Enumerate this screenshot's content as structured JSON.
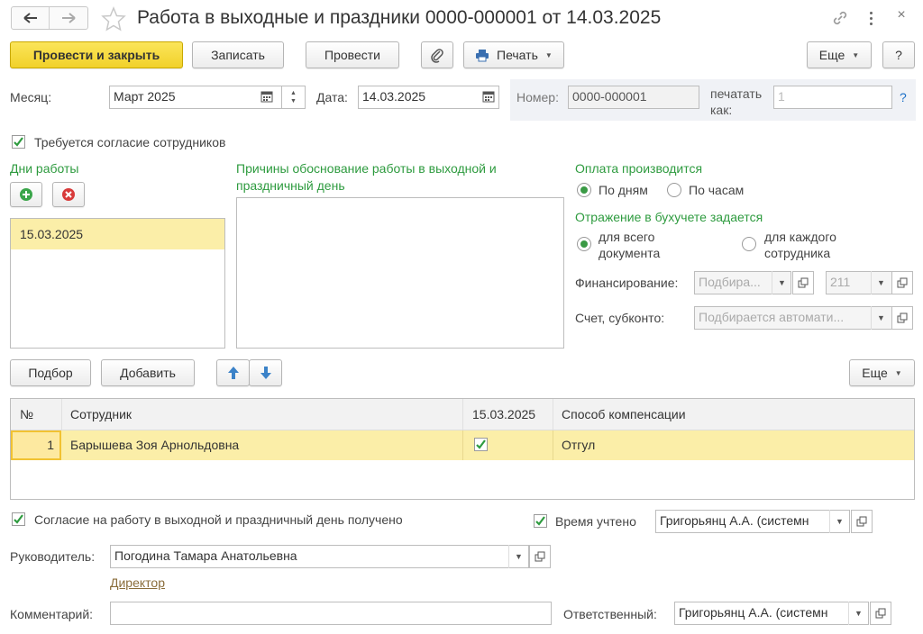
{
  "window": {
    "title": "Работа в выходные и праздники 0000-000001 от 14.03.2025"
  },
  "toolbar": {
    "post_close": "Провести и закрыть",
    "save": "Записать",
    "post": "Провести",
    "print": "Печать",
    "more": "Еще",
    "help": "?"
  },
  "header": {
    "month_label": "Месяц:",
    "month_value": "Март 2025",
    "date_label": "Дата:",
    "date_value": "14.03.2025",
    "number_label": "Номер:",
    "number_value": "0000-000001",
    "print_as_label_1": "печатать",
    "print_as_label_2": "как:",
    "print_as_placeholder": "1",
    "help_q": "?"
  },
  "consent_required": {
    "label": "Требуется согласие сотрудников",
    "checked": true
  },
  "workdays": {
    "title": "Дни работы",
    "items": [
      "15.03.2025"
    ]
  },
  "reasons": {
    "title_line1": "Причины обоснование работы в выходной и",
    "title_line2": "праздничный день",
    "value": ""
  },
  "payment": {
    "title": "Оплата производится",
    "by_days": "По дням",
    "by_hours": "По часам",
    "selected": "by_days"
  },
  "accounting": {
    "title": "Отражение в бухучете задается",
    "whole_doc_1": "для всего",
    "whole_doc_2": "документа",
    "each_emp_1": "для каждого",
    "each_emp_2": "сотрудника",
    "selected": "whole_doc",
    "financing_label": "Финансирование:",
    "financing_placeholder": "Подбира...",
    "financing_code": "211",
    "account_label": "Счет, субконто:",
    "account_placeholder": "Подбирается автомати..."
  },
  "table_toolbar": {
    "select": "Подбор",
    "add": "Добавить",
    "more": "Еще"
  },
  "table": {
    "columns": [
      "№",
      "Сотрудник",
      "15.03.2025",
      "Способ компенсации"
    ],
    "rows": [
      {
        "num": "1",
        "employee": "Барышева Зоя Арнольдовна",
        "day_checked": true,
        "compensation": "Отгул"
      }
    ]
  },
  "footer": {
    "consent_received_label": "Согласие на работу в выходной и праздничный день получено",
    "consent_received_checked": true,
    "time_accounted_label": "Время учтено",
    "time_accounted_checked": true,
    "time_accounted_value": "Григорьянц А.А. (системн",
    "manager_label": "Руководитель:",
    "manager_value": "Погодина Тамара Анатольевна",
    "manager_position": "Директор",
    "comment_label": "Комментарий:",
    "comment_value": "",
    "responsible_label": "Ответственный:",
    "responsible_value": "Григорьянц А.А. (системн"
  },
  "colors": {
    "accent_green": "#2e9b3f",
    "primary_yellow": "#f1d12a",
    "selected_row": "#fbeea8"
  }
}
